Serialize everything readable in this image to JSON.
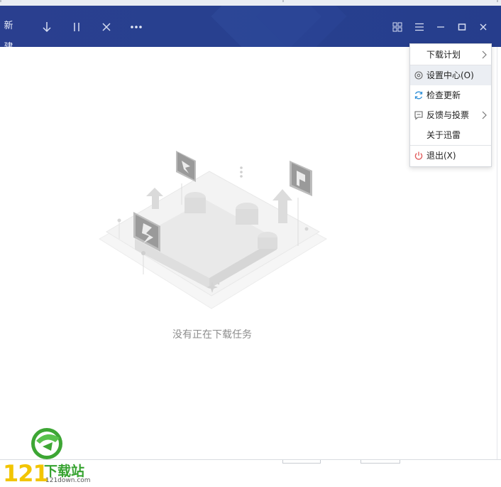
{
  "toolbar": {
    "new_label": "新建",
    "download_icon": "arrow-down-icon",
    "pause_icon": "pause-icon",
    "delete_icon": "close-icon",
    "more_icon": "more-icon",
    "grid_icon": "grid-icon",
    "menu_icon": "hamburger-icon",
    "minimize_icon": "minimize-icon",
    "maximize_icon": "maximize-icon",
    "close_icon": "close-icon",
    "bg_color": "#27408f"
  },
  "main": {
    "empty_text": "没有正在下载任务"
  },
  "menu": {
    "items": [
      {
        "label": "下载计划",
        "icon": "",
        "submenu": true
      },
      {
        "label": "设置中心(O)",
        "icon": "gear-icon",
        "submenu": false,
        "hover": true
      },
      {
        "label": "检查更新",
        "icon": "refresh-icon",
        "submenu": false
      },
      {
        "label": "反馈与投票",
        "icon": "feedback-icon",
        "submenu": true
      },
      {
        "label": "关于迅雷",
        "icon": "",
        "submenu": false
      },
      {
        "label": "退出(X)",
        "icon": "power-icon",
        "submenu": false
      }
    ]
  },
  "watermark": {
    "number": "121",
    "brand": "下载站",
    "url": "121down.com"
  }
}
